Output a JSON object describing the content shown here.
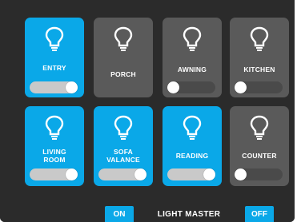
{
  "tiles": [
    {
      "label": "ENTRY",
      "state": "on"
    },
    {
      "label": "PORCH",
      "state": "off"
    },
    {
      "label": "AWNING",
      "state": "off"
    },
    {
      "label": "KITCHEN",
      "state": "off"
    },
    {
      "label": "LIVING ROOM",
      "state": "on"
    },
    {
      "label": "SOFA VALANCE",
      "state": "on"
    },
    {
      "label": "READING",
      "state": "on"
    },
    {
      "label": "COUNTER",
      "state": "off"
    }
  ],
  "master": {
    "label": "LIGHT MASTER",
    "on_label": "ON",
    "off_label": "OFF"
  },
  "colors": {
    "accent": "#0aa8e8",
    "tile_off": "#5a5a5a",
    "panel": "#2b2b2b"
  },
  "icons": {
    "bulb": "lightbulb-icon"
  }
}
